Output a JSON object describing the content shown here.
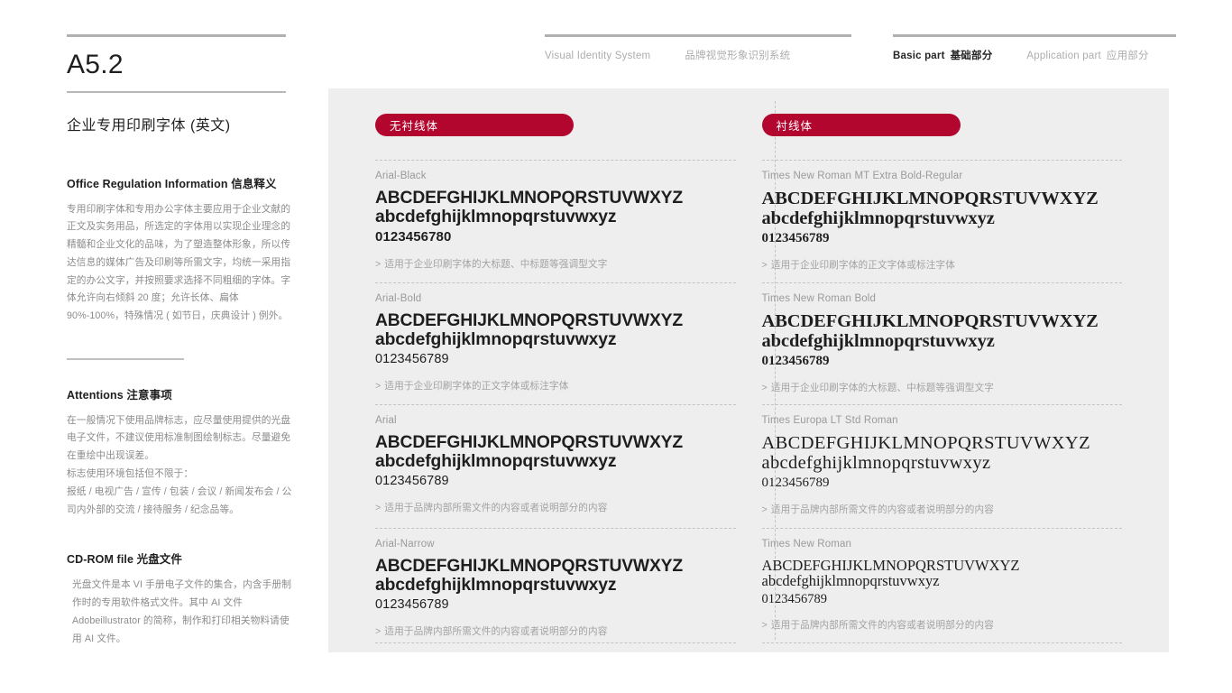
{
  "header": {
    "rule_color": "#b0b0b0",
    "nav_left": {
      "label_en": "Visual Identity System",
      "label_cn": "品牌视觉形象识别系统"
    },
    "nav_right": {
      "basic_en": "Basic part",
      "basic_cn": "基础部分",
      "application_en": "Application part",
      "application_cn": "应用部分"
    }
  },
  "sidebar": {
    "code": "A5.2",
    "title": "企业专用印刷字体 (英文)",
    "sections": [
      {
        "head_en": "Office Regulation Information",
        "head_cn": "信息释义",
        "body": "专用印刷字体和专用办公字体主要应用于企业文献的正文及实务用品，所选定的字体用以实现企业理念的精髓和企业文化的品味，为了塑造整体形象，所以传达信息的媒体广告及印刷等所需文字，均统一采用指定的办公文字，并按照要求选择不同粗细的字体。字体允许向右倾斜 20 度；允许长体、扁体 90%-100%，特殊情况 ( 如节日，庆典设计 ) 例外。"
      },
      {
        "head_en": "Attentions",
        "head_cn": "注意事项",
        "body_p1": "在一般情况下使用品牌标志，应尽量使用提供的光盘电子文件，不建议使用标准制图绘制标志。尽量避免在重绘中出现误差。",
        "body_p2": "标志使用环境包括但不限于：",
        "body_p3": "报纸 / 电视广告 / 宣传 / 包装 / 会议 / 新闻发布会 / 公司内外部的交流 / 接待服务 / 纪念品等。"
      },
      {
        "head_en": "CD-ROM file",
        "head_cn": "光盘文件",
        "body": "光盘文件是本 VI 手册电子文件的集合，内含手册制作时的专用软件格式文件。其中 AI 文件 Adobeillustrator 的简称，制作和打印相关物料请使用 AI 文件。"
      }
    ]
  },
  "panel": {
    "background": "#eeeeee",
    "accent": "#b2062e",
    "columns": [
      {
        "pill_label": "无衬线体",
        "specimens": [
          {
            "name": "Arial-Black",
            "upper": "ABCDEFGHIJKLMNOPQRSTUVWXYZ",
            "lower": "abcdefghijklmnopqrstuvwxyz",
            "numerals": "0123456780",
            "note_caret": ">",
            "note": "适用于企业印刷字体的大标题、中标题等强调型文字"
          },
          {
            "name": "Arial-Bold",
            "upper": "ABCDEFGHIJKLMNOPQRSTUVWXYZ",
            "lower": "abcdefghijklmnopqrstuvwxyz",
            "numerals": "0123456789",
            "note_caret": ">",
            "note": "适用于企业印刷字体的正文字体或标注字体"
          },
          {
            "name": "Arial",
            "upper": "ABCDEFGHIJKLMNOPQRSTUVWXYZ",
            "lower": "abcdefghijklmnopqrstuvwxyz",
            "numerals": "0123456789",
            "note_caret": ">",
            "note": "适用于品牌内部所需文件的内容或者说明部分的内容"
          },
          {
            "name": "Arial-Narrow",
            "upper": "ABCDEFGHIJKLMNOPQRSTUVWXYZ",
            "lower": "abcdefghijklmnopqrstuvwxyz",
            "numerals": "0123456789",
            "note_caret": ">",
            "note": "适用于品牌内部所需文件的内容或者说明部分的内容"
          }
        ]
      },
      {
        "pill_label": "衬线体",
        "specimens": [
          {
            "name": "Times New Roman MT Extra Bold-Regular",
            "upper": "ABCDEFGHIJKLMNOPQRSTUVWXYZ",
            "lower": "abcdefghijklmnopqrstuvwxyz",
            "numerals": "0123456789",
            "note_caret": ">",
            "note": "适用于企业印刷字体的正文字体或标注字体"
          },
          {
            "name": "Times New Roman Bold",
            "upper": "ABCDEFGHIJKLMNOPQRSTUVWXYZ",
            "lower": "abcdefghijklmnopqrstuvwxyz",
            "numerals": "0123456789",
            "note_caret": ">",
            "note": "适用于企业印刷字体的大标题、中标题等强调型文字"
          },
          {
            "name": "Times Europa LT Std Roman",
            "upper": "ABCDEFGHIJKLMNOPQRSTUVWXYZ",
            "lower": "abcdefghijklmnopqrstuvwxyz",
            "numerals": "0123456789",
            "note_caret": ">",
            "note": "适用于品牌内部所需文件的内容或者说明部分的内容"
          },
          {
            "name": "Times New Roman",
            "upper": "ABCDEFGHIJKLMNOPQRSTUVWXYZ",
            "lower": "abcdefghijklmnopqrstuvwxyz",
            "numerals": "0123456789",
            "note_caret": ">",
            "note": "适用于品牌内部所需文件的内容或者说明部分的内容"
          }
        ]
      }
    ]
  }
}
